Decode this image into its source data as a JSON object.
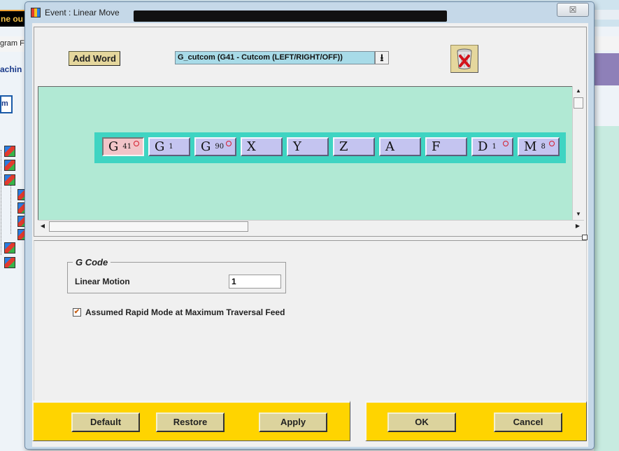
{
  "background": {
    "orange_tab_text": "ne ou",
    "menu_text": "gram F",
    "machine_text": "achin",
    "tab_text": "m"
  },
  "dialog": {
    "title": "Event : Linear Move",
    "close_glyph": "☒"
  },
  "toolbar": {
    "add_word_label": "Add Word",
    "word_select_value": "G_cutcom (G41 - Cutcom (LEFT/RIGHT/OFF))",
    "dropdown_glyph": "⭳",
    "delete_icon": "trash-icon"
  },
  "words": [
    {
      "letter": "G",
      "sub": "41",
      "dot": true,
      "selected": true
    },
    {
      "letter": "G",
      "sub": "1",
      "dot": false,
      "selected": false
    },
    {
      "letter": "G",
      "sub": "90",
      "dot": true,
      "selected": false
    },
    {
      "letter": "X",
      "sub": "",
      "dot": false,
      "selected": false
    },
    {
      "letter": "Y",
      "sub": "",
      "dot": false,
      "selected": false
    },
    {
      "letter": "Z",
      "sub": "",
      "dot": false,
      "selected": false
    },
    {
      "letter": "A",
      "sub": "",
      "dot": false,
      "selected": false
    },
    {
      "letter": "F",
      "sub": "",
      "dot": false,
      "selected": false
    },
    {
      "letter": "D",
      "sub": "1",
      "dot": true,
      "selected": false
    },
    {
      "letter": "M",
      "sub": "8",
      "dot": true,
      "selected": false
    }
  ],
  "gcode_group": {
    "legend": "G Code",
    "linear_motion_label": "Linear Motion",
    "linear_motion_value": "1"
  },
  "assumed_rapid": {
    "checked": true,
    "check_glyph": "✔",
    "label": "Assumed Rapid Mode at Maximum Traversal Feed"
  },
  "buttons": {
    "default": "Default",
    "restore": "Restore",
    "apply": "Apply",
    "ok": "OK",
    "cancel": "Cancel"
  },
  "colors": {
    "canvas_bg": "#b1e9d4",
    "word_strip": "#3fd4c2",
    "word_bg": "#c4c4f0",
    "word_selected_bg": "#f2c4c8",
    "bar_yellow": "#ffd400",
    "button_bg": "#dcd39d"
  }
}
